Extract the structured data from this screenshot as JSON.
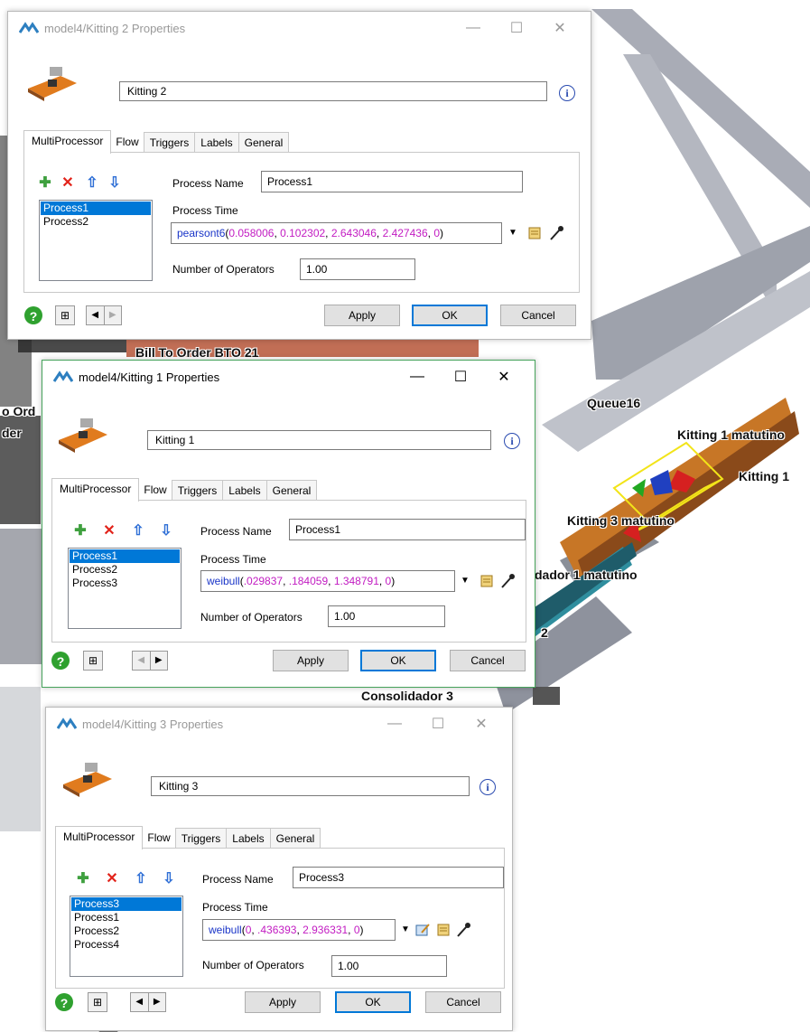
{
  "scene_labels": {
    "bill_to_order": "Bill To Order  BTO 21",
    "order_left": "o Ord",
    "order_left2": "der",
    "queue16": "Queue16",
    "kitting1_matutino": "Kitting 1 matutino",
    "kitting1": "Kitting 1",
    "kitting3_matutino": "Kitting 3 matutino",
    "consolidador1_matutino": "dador 1 matutino",
    "num2": "2",
    "consolidador3": "Consolidador 3"
  },
  "tabs": [
    "MultiProcessor",
    "Flow",
    "Triggers",
    "Labels",
    "General"
  ],
  "labels": {
    "process_name": "Process Name",
    "process_time": "Process Time",
    "number_of_operators": "Number of Operators"
  },
  "buttons": {
    "apply": "Apply",
    "ok": "OK",
    "cancel": "Cancel"
  },
  "icons": {
    "help": "?",
    "info": "i",
    "add": "plus-icon",
    "delete": "x-icon",
    "up": "arrow-up-icon",
    "down": "arrow-down-icon"
  },
  "dialogs": [
    {
      "title": "model4/Kitting 2  Properties",
      "object_name": "Kitting 2",
      "processes": [
        "Process1",
        "Process2"
      ],
      "process_name": "Process1",
      "process_time": {
        "fn": "pearsont6",
        "args": [
          "0.058006",
          "0.102302",
          "2.643046",
          "2.427436",
          "0"
        ]
      },
      "operators": "1.00"
    },
    {
      "title": "model4/Kitting 1  Properties",
      "object_name": "Kitting 1",
      "processes": [
        "Process1",
        "Process2",
        "Process3"
      ],
      "process_name": "Process1",
      "process_time": {
        "fn": "weibull",
        "args": [
          ".029837",
          ".184059",
          "1.348791",
          "0"
        ]
      },
      "operators": "1.00"
    },
    {
      "title": "model4/Kitting 3  Properties",
      "object_name": "Kitting 3",
      "processes": [
        "Process3",
        "Process1",
        "Process2",
        "Process4"
      ],
      "process_name": "Process3",
      "process_time": {
        "fn": "weibull",
        "args": [
          "0",
          ".436393",
          "2.936331",
          "0"
        ]
      },
      "operators": "1.00"
    }
  ]
}
